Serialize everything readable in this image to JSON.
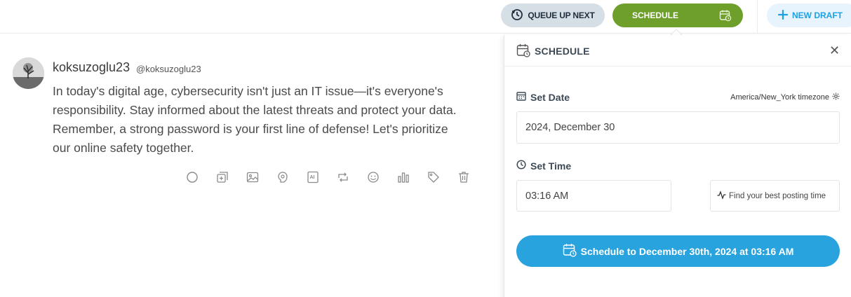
{
  "toolbar": {
    "queue_label": "QUEUE UP NEXT",
    "schedule_label": "SCHEDULE",
    "new_draft_label": "NEW DRAFT"
  },
  "tweet": {
    "display_name": "koksuzoglu23",
    "handle": "@koksuzoglu23",
    "text": "In today's digital age, cybersecurity isn't just an IT issue—it's everyone's responsibility. Stay informed about the latest threats and protect your data. Remember, a strong password is your first line of defense! Let's prioritize our online safety together.",
    "actions": [
      "circle-progress-icon",
      "add-thread-icon",
      "image-icon",
      "gif-icon",
      "ai-icon",
      "retweet-icon",
      "emoji-icon",
      "analytics-icon",
      "tag-icon",
      "trash-icon"
    ]
  },
  "schedule_panel": {
    "title": "SCHEDULE",
    "set_date_label": "Set Date",
    "timezone": "America/New_York timezone",
    "date_value": "2024, December 30",
    "set_time_label": "Set Time",
    "time_value": "03:16 AM",
    "best_time_label": "Find your best posting time",
    "confirm_label": "Schedule to December 30th, 2024 at 03:16 AM"
  },
  "colors": {
    "schedule_green": "#6e9f2b",
    "primary_blue": "#29a3de",
    "queue_gray": "#d6dee6"
  }
}
